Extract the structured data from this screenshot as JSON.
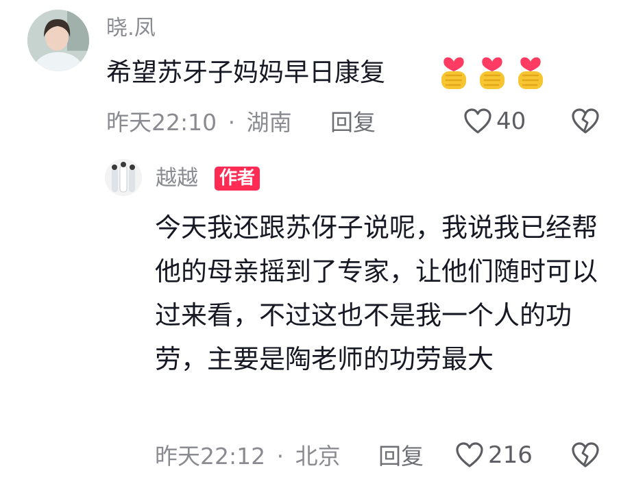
{
  "comment": {
    "username": "晓.凤",
    "text": "希望苏牙子妈妈早日康复",
    "emoji_icon": "finger-heart-emoji",
    "emoji_count": 3,
    "time": "昨天22:10",
    "location": "湖南",
    "separator": "·",
    "reply_label": "回复",
    "likes": "40"
  },
  "reply": {
    "username": "越越",
    "badge": "作者",
    "text": "今天我还跟苏伢子说呢，我说我已经帮他的母亲摇到了专家，让他们随时可以过来看，不过这也不是我一个人的功劳，主要是陶老师的功劳最大",
    "time": "昨天22:12",
    "location": "北京",
    "separator": "·",
    "reply_label": "回复",
    "likes": "216"
  },
  "colors": {
    "badge_bg": "#fe2c55",
    "meta_gray": "#8a8b91",
    "text_dark": "#161823"
  }
}
